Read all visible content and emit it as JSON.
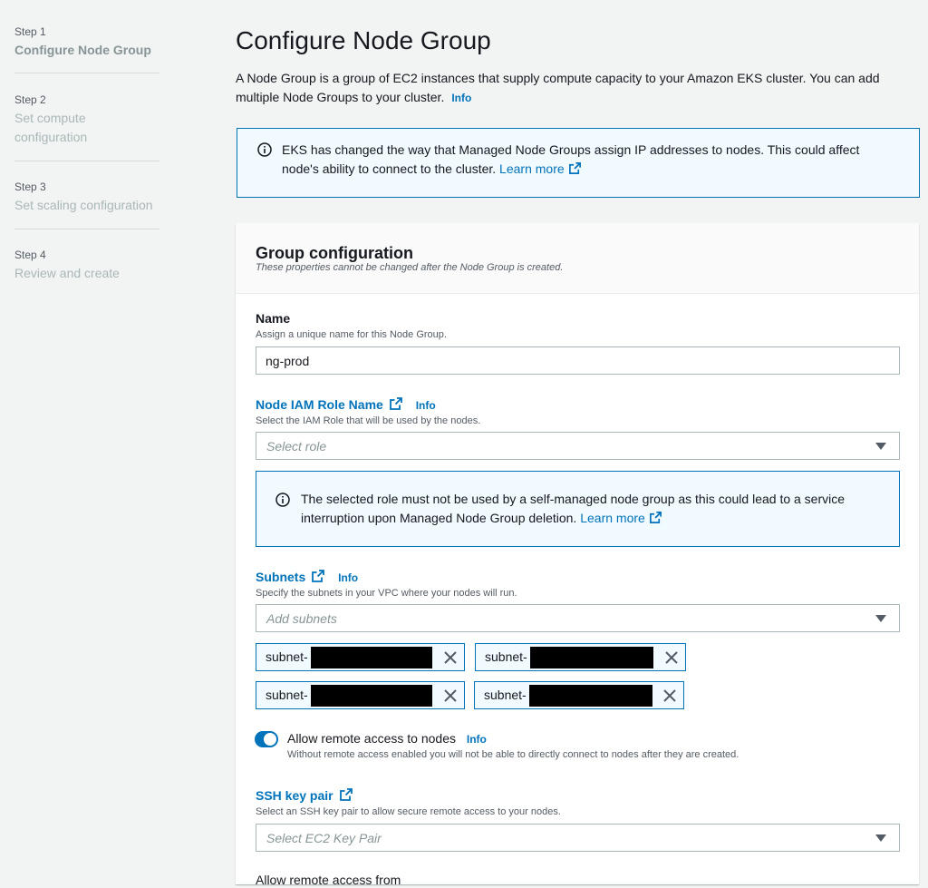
{
  "sidebar": {
    "steps": [
      {
        "num": "Step 1",
        "title": "Configure Node Group"
      },
      {
        "num": "Step 2",
        "title": "Set compute configuration"
      },
      {
        "num": "Step 3",
        "title": "Set scaling configuration"
      },
      {
        "num": "Step 4",
        "title": "Review and create"
      }
    ]
  },
  "header": {
    "title": "Configure Node Group",
    "description": "A Node Group is a group of EC2 instances that supply compute capacity to your Amazon EKS cluster. You can add multiple Node Groups to your cluster.",
    "info": "Info"
  },
  "alert_top": {
    "text": "EKS has changed the way that Managed Node Groups assign IP addresses to nodes. This could affect node's ability to connect to the cluster.",
    "link": "Learn more"
  },
  "group": {
    "title": "Group configuration",
    "subtitle": "These properties cannot be changed after the Node Group is created.",
    "name": {
      "label": "Name",
      "description": "Assign a unique name for this Node Group.",
      "value": "ng-prod"
    },
    "role": {
      "label": "Node IAM Role Name",
      "info": "Info",
      "description": "Select the IAM Role that will be used by the nodes.",
      "placeholder": "Select role"
    },
    "role_alert": {
      "text": "The selected role must not be used by a self-managed node group as this could lead to a service interruption upon Managed Node Group deletion.",
      "link": "Learn more"
    },
    "subnets": {
      "label": "Subnets",
      "info": "Info",
      "description": "Specify the subnets in your VPC where your nodes will run.",
      "placeholder": "Add subnets",
      "tokens": [
        "subnet-",
        "subnet-",
        "subnet-",
        "subnet-"
      ]
    },
    "remote_access": {
      "label": "Allow remote access to nodes",
      "info": "Info",
      "description": "Without remote access enabled you will not be able to directly connect to nodes after they are created.",
      "enabled": true
    },
    "ssh": {
      "label": "SSH key pair",
      "description": "Select an SSH key pair to allow secure remote access to your nodes.",
      "placeholder": "Select EC2 Key Pair"
    },
    "remote_from": {
      "label": "Allow remote access from"
    }
  },
  "colors": {
    "accent": "#0073bb",
    "background": "#f2f3f3",
    "alert_bg": "#f1faff"
  }
}
